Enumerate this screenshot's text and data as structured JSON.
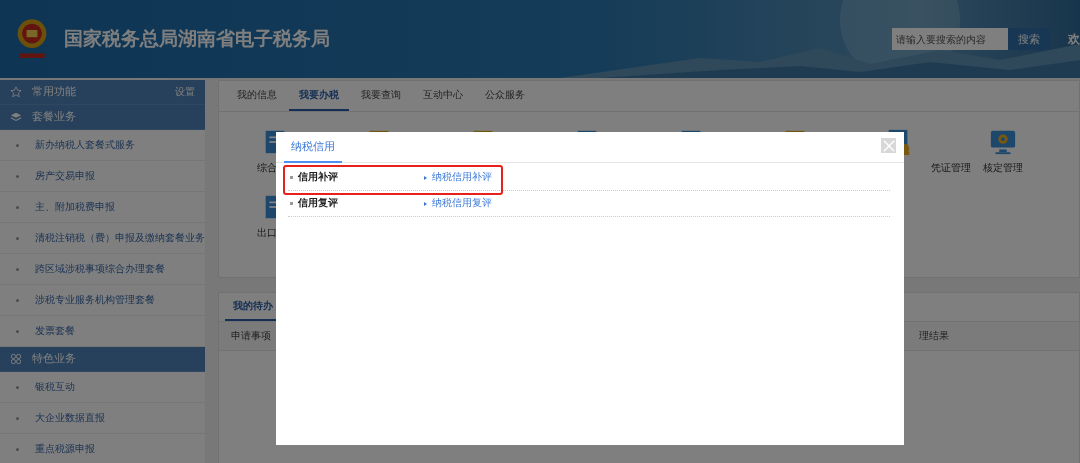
{
  "header": {
    "title": "国家税务总局湖南省电子税务局",
    "search": {
      "placeholder": "请输入要搜索的内容"
    },
    "search_button": "搜索",
    "user_text": "欢"
  },
  "sidebar": [
    {
      "title": "常用功能",
      "action": "设置"
    },
    {
      "title": "套餐业务",
      "items": [
        "新办纳税人套餐式服务",
        "房产交易申报",
        "主、附加税费申报",
        "清税注销税（费）申报及缴纳套餐业务",
        "跨区域涉税事项综合办理套餐",
        "涉税专业服务机构管理套餐",
        "发票套餐"
      ]
    },
    {
      "title": "特色业务",
      "items": [
        "银税互动",
        "大企业数据直报",
        "重点税源申报"
      ]
    }
  ],
  "tabs": [
    {
      "label": "我的信息",
      "selected": false
    },
    {
      "label": "我要办税",
      "selected": true
    },
    {
      "label": "我要查询",
      "selected": false
    },
    {
      "label": "互动中心",
      "selected": false
    },
    {
      "label": "公众服务",
      "selected": false
    }
  ],
  "tiles": [
    {
      "kind": "document",
      "label": "综合"
    },
    {
      "kind": "folder"
    },
    {
      "kind": "folder"
    },
    {
      "kind": "document"
    },
    {
      "kind": "document"
    },
    {
      "kind": "folder"
    },
    {
      "kind": "certificate",
      "label": "凭证管理"
    },
    {
      "kind": "monitor",
      "label": "核定管理"
    },
    {
      "kind": "document",
      "label": "出口"
    }
  ],
  "lower_panel": {
    "tabs": [
      {
        "label": "我的待办",
        "selected": true
      }
    ],
    "columns": [
      "申请事项",
      "理结果"
    ]
  },
  "modal": {
    "tabs": [
      {
        "label": "纳税信用",
        "selected": true
      }
    ],
    "rows": [
      {
        "category": "信用补评",
        "link": "纳税信用补评",
        "highlighted": true
      },
      {
        "category": "信用复评",
        "link": "纳税信用复评",
        "highlighted": false
      }
    ]
  }
}
